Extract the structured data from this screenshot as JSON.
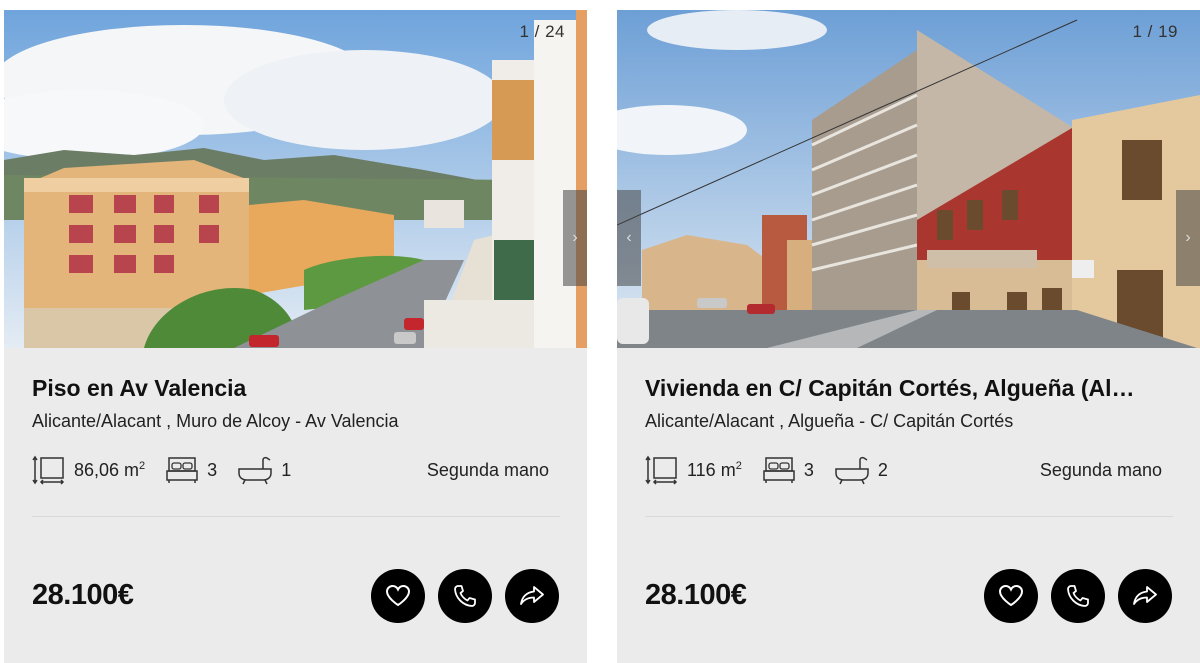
{
  "listings": [
    {
      "photo_counter": "1 / 24",
      "title": "Piso en Av Valencia",
      "location": "Alicante/Alacant , Muro de Alcoy - Av Valencia",
      "area_value": "86,06 m",
      "area_unit_sup": "2",
      "bedrooms": "3",
      "bathrooms": "1",
      "condition": "Segunda mano",
      "price": "28.100€",
      "icons": [
        "area-icon",
        "bed-icon",
        "bath-icon",
        "heart-icon",
        "phone-icon",
        "share-icon"
      ]
    },
    {
      "photo_counter": "1 / 19",
      "title": "Vivienda en C/ Capitán Cortés, Algueña (Al…",
      "location": "Alicante/Alacant , Algueña - C/ Capitán Cortés",
      "area_value": "116 m",
      "area_unit_sup": "2",
      "bedrooms": "3",
      "bathrooms": "2",
      "condition": "Segunda mano",
      "price": "28.100€",
      "icons": [
        "area-icon",
        "bed-icon",
        "bath-icon",
        "heart-icon",
        "phone-icon",
        "share-icon"
      ]
    }
  ],
  "colors": {
    "card_bg": "#ebebeb",
    "button_bg": "#000000",
    "text": "#111111"
  }
}
